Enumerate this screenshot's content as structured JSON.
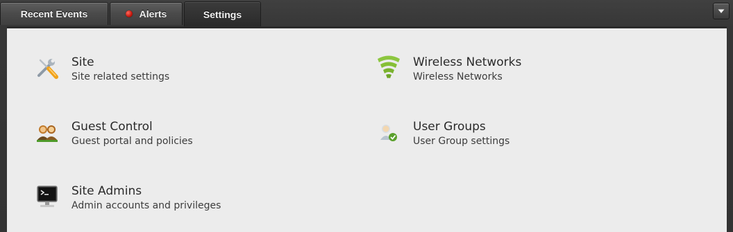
{
  "tabs": [
    {
      "label": "Recent Events",
      "active": false
    },
    {
      "label": "Alerts",
      "active": false,
      "indicator_color": "#d42015"
    },
    {
      "label": "Settings",
      "active": true
    }
  ],
  "menu": {
    "icon": "chevron-down-icon"
  },
  "settings": {
    "site": {
      "title": "Site",
      "description": "Site related settings",
      "icon": "tools-icon"
    },
    "wireless": {
      "title": "Wireless Networks",
      "description": "Wireless Networks",
      "icon": "wifi-icon"
    },
    "guest": {
      "title": "Guest Control",
      "description": "Guest portal and policies",
      "icon": "guests-icon"
    },
    "groups": {
      "title": "User Groups",
      "description": "User Group settings",
      "icon": "user-group-icon"
    },
    "admins": {
      "title": "Site Admins",
      "description": "Admin accounts and privileges",
      "icon": "monitor-icon"
    }
  },
  "colors": {
    "panel_bg": "#ececec",
    "tabbar_bg": "#3a3a3a",
    "wifi_green": "#7fb82a"
  }
}
